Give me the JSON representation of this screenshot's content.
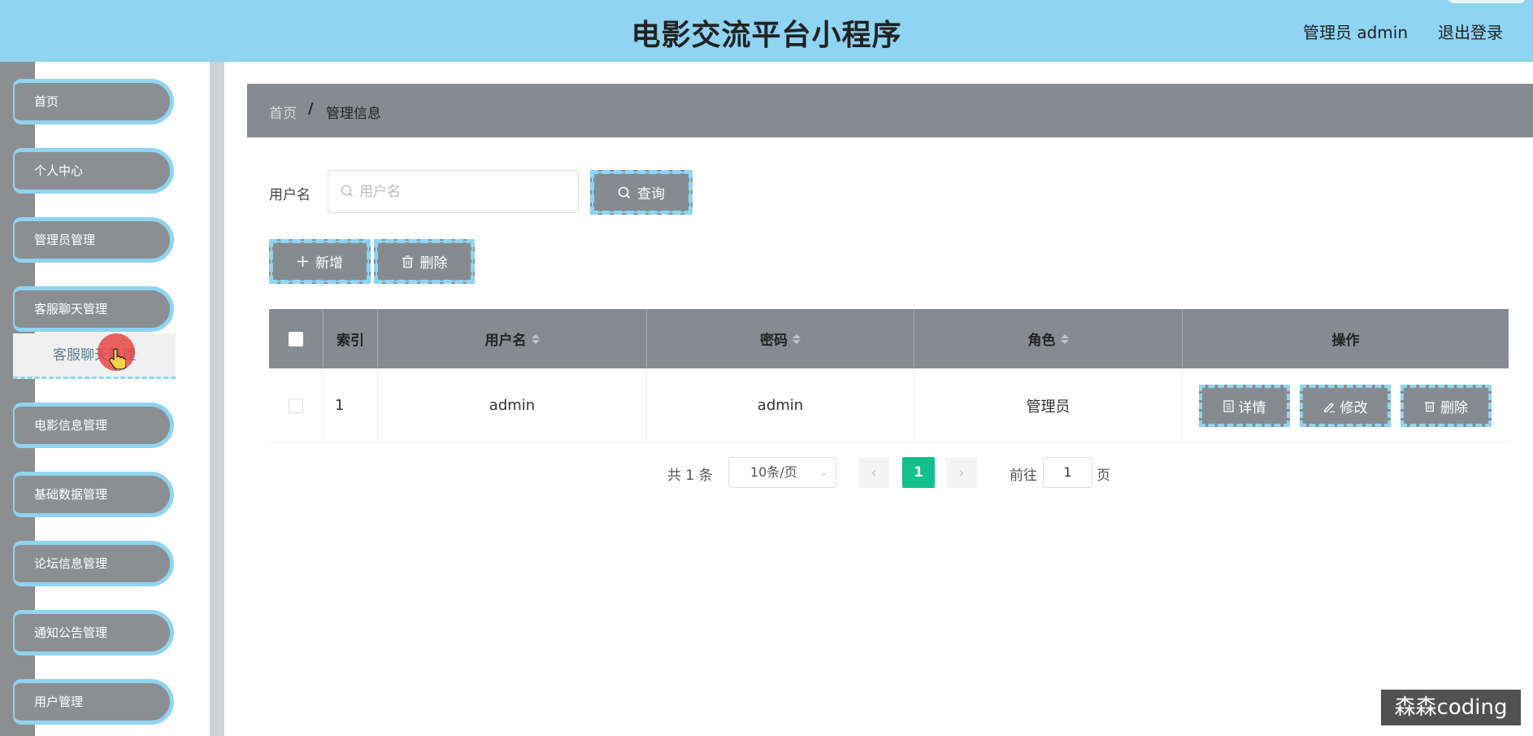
{
  "header": {
    "title": "电影交流平台小程序",
    "user_label": "管理员 admin",
    "logout_label": "退出登录"
  },
  "sidebar": {
    "items": [
      {
        "label": "首页"
      },
      {
        "label": "个人中心"
      },
      {
        "label": "管理员管理"
      },
      {
        "label": "客服聊天管理"
      },
      {
        "label": "电影信息管理"
      },
      {
        "label": "基础数据管理"
      },
      {
        "label": "论坛信息管理"
      },
      {
        "label": "通知公告管理"
      },
      {
        "label": "用户管理"
      }
    ],
    "submenu_active": "客服聊天管理"
  },
  "breadcrumb": {
    "home": "首页",
    "separator": "/",
    "current": "管理信息"
  },
  "search": {
    "label": "用户名",
    "placeholder": "用户名",
    "value": "",
    "query_label": "查询"
  },
  "toolbar": {
    "add_label": "新增",
    "delete_label": "删除"
  },
  "table": {
    "columns": [
      "索引",
      "用户名",
      "密码",
      "角色",
      "操作"
    ],
    "rows": [
      {
        "index": "1",
        "username": "admin",
        "password": "admin",
        "role": "管理员"
      }
    ],
    "actions": {
      "detail": "详情",
      "edit": "修改",
      "delete": "删除"
    }
  },
  "pagination": {
    "total": "共 1 条",
    "page_size": "10条/页",
    "current_page": "1",
    "goto_label": "前往",
    "goto_value": "1",
    "page_suffix": "页"
  },
  "watermark": "森森coding",
  "colors": {
    "header_bg": "#8fd4f2",
    "accent_gray": "#868b8f",
    "pager_active": "#13c08a"
  }
}
